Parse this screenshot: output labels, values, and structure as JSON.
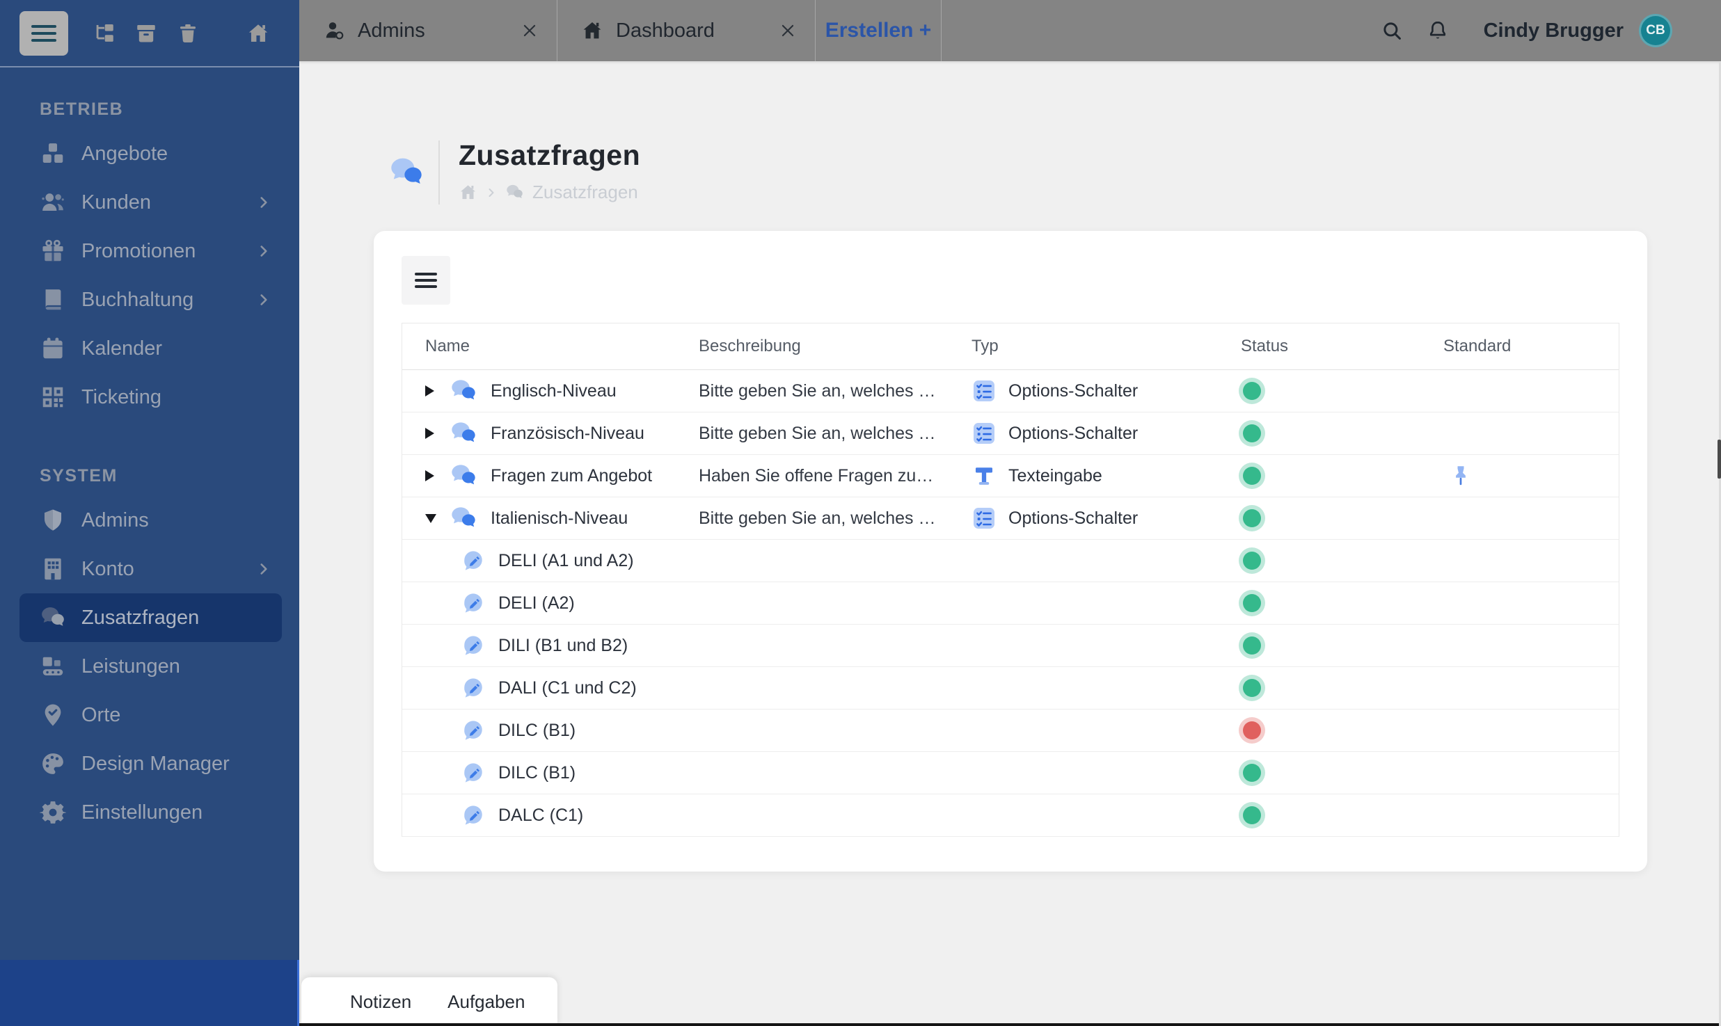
{
  "colors": {
    "sidebar_bg": "#2a4a7c",
    "sidebar_bottom_bg": "#1d4289",
    "sidebar_active_bg": "#16356b",
    "topbar_bg": "#848484",
    "accent_blue": "#2f6fe0",
    "create_tab_blue": "#2b55a8",
    "status_active": "#35b98c",
    "status_inactive": "#e0605e",
    "avatar_teal": "#178291",
    "content_bg": "#f0f0f0",
    "card_bg": "#ffffff"
  },
  "sidebar": {
    "toolbar_icons": [
      "menu",
      "sitemap",
      "archive",
      "trash",
      "home"
    ],
    "sections": [
      {
        "title": "BETRIEB",
        "items": [
          {
            "label": "Angebote",
            "icon": "cubes",
            "chevron": false,
            "active": false
          },
          {
            "label": "Kunden",
            "icon": "users",
            "chevron": true,
            "active": false
          },
          {
            "label": "Promotionen",
            "icon": "gift",
            "chevron": true,
            "active": false
          },
          {
            "label": "Buchhaltung",
            "icon": "book",
            "chevron": true,
            "active": false
          },
          {
            "label": "Kalender",
            "icon": "calendar",
            "chevron": false,
            "active": false
          },
          {
            "label": "Ticketing",
            "icon": "qr",
            "chevron": false,
            "active": false
          }
        ]
      },
      {
        "title": "SYSTEM",
        "items": [
          {
            "label": "Admins",
            "icon": "shield",
            "chevron": false,
            "active": false
          },
          {
            "label": "Konto",
            "icon": "building",
            "chevron": true,
            "active": false
          },
          {
            "label": "Zusatzfragen",
            "icon": "chat",
            "chevron": false,
            "active": true
          },
          {
            "label": "Leistungen",
            "icon": "conveyor",
            "chevron": false,
            "active": false
          },
          {
            "label": "Orte",
            "icon": "pinloc",
            "chevron": false,
            "active": false
          },
          {
            "label": "Design Manager",
            "icon": "palette",
            "chevron": false,
            "active": false
          },
          {
            "label": "Einstellungen",
            "icon": "gear",
            "chevron": false,
            "active": false
          }
        ]
      }
    ]
  },
  "topbar": {
    "tabs": [
      {
        "label": "Admins",
        "icon": "person",
        "closable": true,
        "accent": false
      },
      {
        "label": "Dashboard",
        "icon": "home",
        "closable": true,
        "accent": false
      },
      {
        "label": "Erstellen +",
        "icon": null,
        "closable": false,
        "accent": true
      }
    ],
    "search_icon": "search",
    "bell_icon": "bell",
    "user": {
      "name": "Cindy Brugger",
      "initials": "CB"
    }
  },
  "page": {
    "title": "Zusatzfragen",
    "breadcrumb": {
      "home_icon": "home",
      "item_icon": "chat",
      "label": "Zusatzfragen"
    }
  },
  "table": {
    "columns": [
      "Name",
      "Beschreibung",
      "Typ",
      "Status",
      "Standard"
    ],
    "rows": [
      {
        "name": "Englisch-Niveau",
        "description": "Bitte geben Sie an, welches …",
        "type": "Options-Schalter",
        "type_icon": "options",
        "status": "active",
        "standard": false,
        "level": 0,
        "arrow": "collapsed"
      },
      {
        "name": "Französisch-Niveau",
        "description": "Bitte geben Sie an, welches …",
        "type": "Options-Schalter",
        "type_icon": "options",
        "status": "active",
        "standard": false,
        "level": 0,
        "arrow": "collapsed"
      },
      {
        "name": "Fragen zum Angebot",
        "description": "Haben Sie offene Fragen zu…",
        "type": "Texteingabe",
        "type_icon": "text",
        "status": "active",
        "standard": true,
        "level": 0,
        "arrow": "collapsed"
      },
      {
        "name": "Italienisch-Niveau",
        "description": "Bitte geben Sie an, welches …",
        "type": "Options-Schalter",
        "type_icon": "options",
        "status": "active",
        "standard": false,
        "level": 0,
        "arrow": "expanded"
      },
      {
        "name": "DELI (A1 und A2)",
        "description": "",
        "type": "",
        "type_icon": null,
        "status": "active",
        "standard": false,
        "level": 1,
        "arrow": null
      },
      {
        "name": "DELI (A2)",
        "description": "",
        "type": "",
        "type_icon": null,
        "status": "active",
        "standard": false,
        "level": 1,
        "arrow": null
      },
      {
        "name": "DILI (B1 und B2)",
        "description": "",
        "type": "",
        "type_icon": null,
        "status": "active",
        "standard": false,
        "level": 1,
        "arrow": null
      },
      {
        "name": "DALI (C1 und C2)",
        "description": "",
        "type": "",
        "type_icon": null,
        "status": "active",
        "standard": false,
        "level": 1,
        "arrow": null
      },
      {
        "name": "DILC (B1)",
        "description": "",
        "type": "",
        "type_icon": null,
        "status": "inactive",
        "standard": false,
        "level": 1,
        "arrow": null
      },
      {
        "name": "DILC (B1)",
        "description": "",
        "type": "",
        "type_icon": null,
        "status": "active",
        "standard": false,
        "level": 1,
        "arrow": null
      },
      {
        "name": "DALC (C1)",
        "description": "",
        "type": "",
        "type_icon": null,
        "status": "active",
        "standard": false,
        "level": 1,
        "arrow": null
      }
    ]
  },
  "bottombar": {
    "menu_icon": "dots-v",
    "items": [
      "Notizen",
      "Aufgaben"
    ]
  }
}
